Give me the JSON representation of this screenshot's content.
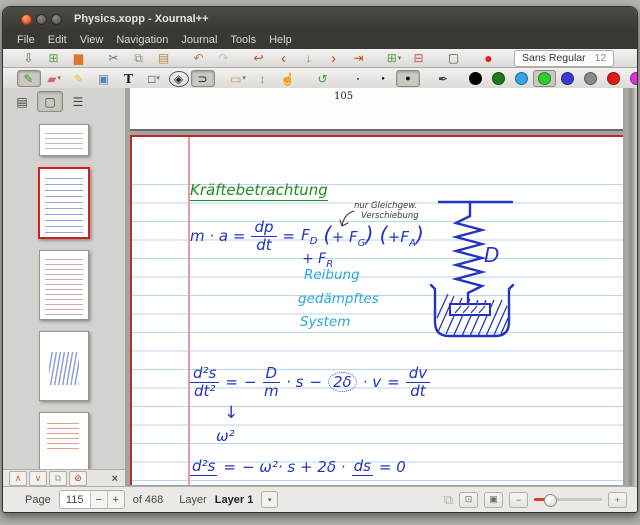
{
  "window": {
    "title": "Physics.xopp - Xournal++"
  },
  "menu": {
    "items": [
      {
        "name": "menu-file",
        "label": "File"
      },
      {
        "name": "menu-edit",
        "label": "Edit"
      },
      {
        "name": "menu-view",
        "label": "View"
      },
      {
        "name": "menu-navigation",
        "label": "Navigation"
      },
      {
        "name": "menu-journal",
        "label": "Journal"
      },
      {
        "name": "menu-tools",
        "label": "Tools"
      },
      {
        "name": "menu-help",
        "label": "Help"
      }
    ]
  },
  "toolbar_main": {
    "buttons": [
      {
        "name": "save-button",
        "glyph": "⇩",
        "color": "#47743f"
      },
      {
        "name": "new-document-button",
        "glyph": "⊞",
        "color": "#5f9e4c"
      },
      {
        "name": "open-button",
        "glyph": "▆",
        "color": "#e0762e"
      },
      {
        "name": "cut-button",
        "glyph": "✂",
        "color": "#6f6d68",
        "gap": true
      },
      {
        "name": "copy-button",
        "glyph": "⧉",
        "color": "#8f8d88"
      },
      {
        "name": "paste-button",
        "glyph": "▤",
        "color": "#b5884a"
      },
      {
        "name": "undo-button",
        "glyph": "↶",
        "color": "#c2704f",
        "gap": true
      },
      {
        "name": "redo-button",
        "glyph": "↷",
        "color": "#c6c3bd"
      },
      {
        "name": "page-back-button",
        "glyph": "↩",
        "color": "#c14a28",
        "gap": true
      },
      {
        "name": "previous-page-button",
        "glyph": "‹",
        "color": "#c14a28",
        "fs": "15px"
      },
      {
        "name": "scroll-down-button",
        "glyph": "↓",
        "color": "#56a23f"
      },
      {
        "name": "next-page-button",
        "glyph": "›",
        "color": "#c14a28",
        "fs": "15px"
      },
      {
        "name": "last-page-button",
        "glyph": "⇥",
        "color": "#c14a28"
      },
      {
        "name": "insert-page-button",
        "glyph": "⊞",
        "color": "#5f9e4c",
        "dd": "▾",
        "gap": true
      },
      {
        "name": "delete-page-button",
        "glyph": "⊟",
        "color": "#c0564a"
      },
      {
        "name": "presentation-button",
        "glyph": "▢",
        "color": "#55534d",
        "gap": true
      },
      {
        "name": "record-audio-button",
        "glyph": "●",
        "color": "#dc1e1e",
        "fs": "14px",
        "gap": true
      }
    ],
    "font_button": {
      "family": "Sans Regular",
      "size": "12"
    }
  },
  "toolbar_tools": {
    "buttons": [
      {
        "name": "pen-tool-button",
        "glyph": "✎",
        "color": "#3f8f3c",
        "active": true
      },
      {
        "name": "eraser-tool-button",
        "glyph": "▰",
        "color": "#d26a6a",
        "dd": "▾"
      },
      {
        "name": "highlighter-tool-button",
        "glyph": "✎",
        "color": "#d4c829"
      },
      {
        "name": "image-tool-button",
        "glyph": "▣",
        "color": "#5b7fb4"
      },
      {
        "name": "text-tool-button",
        "glyph": "T",
        "color": "#1c1c1c"
      },
      {
        "name": "shape-tool-button",
        "glyph": "□",
        "color": "#333333",
        "dd": "▾"
      },
      {
        "name": "rotation-snapping-button",
        "glyph": "◈",
        "color": "#222222",
        "gap": true
      },
      {
        "name": "grid-snapping-button",
        "glyph": "⊃",
        "color": "#222222",
        "active": true
      },
      {
        "name": "select-rectangle-button",
        "glyph": "▭",
        "color": "#c89a5a",
        "dd": "▾",
        "gap": true
      },
      {
        "name": "vertical-space-button",
        "glyph": "↕",
        "color": "#b5884a"
      },
      {
        "name": "hand-tool-button",
        "glyph": "☝",
        "color": "#2b2b2b"
      },
      {
        "name": "default-tool-button",
        "glyph": "↺",
        "color": "#3f9d3f",
        "gap": true
      }
    ],
    "thickness": [
      {
        "name": "thickness-fine-button",
        "glyph": "●",
        "color": "#111111",
        "fs": "4px",
        "gap": true
      },
      {
        "name": "thickness-medium-button",
        "glyph": "●",
        "color": "#111111",
        "fs": "6px"
      },
      {
        "name": "thickness-thick-button",
        "glyph": "●",
        "color": "#111111",
        "fs": "9px",
        "active": true
      }
    ],
    "color_picker_glyph": "✒",
    "colors": [
      {
        "name": "color-swatch-black",
        "hex": "#000000"
      },
      {
        "name": "color-swatch-dark-green",
        "hex": "#1d7a1d"
      },
      {
        "name": "color-swatch-light-blue",
        "hex": "#35a6e0"
      },
      {
        "name": "color-swatch-green",
        "hex": "#2ecc2e",
        "selected": true
      },
      {
        "name": "color-swatch-blue",
        "hex": "#3b3bd1"
      },
      {
        "name": "color-swatch-gray",
        "hex": "#8a8a8a"
      },
      {
        "name": "color-swatch-red",
        "hex": "#e01b1b"
      },
      {
        "name": "color-swatch-magenta",
        "hex": "#e231e2"
      },
      {
        "name": "color-swatch-orange",
        "hex": "#f08c1e"
      },
      {
        "name": "color-swatch-yellow",
        "hex": "#f0e11e"
      },
      {
        "name": "color-swatch-white",
        "hex": "#ffffff"
      }
    ],
    "custom_color": {
      "hex": "#2ecc2e"
    }
  },
  "sidebar": {
    "tabs": [
      {
        "name": "tab-contents",
        "glyph": "▤"
      },
      {
        "name": "tab-page-preview",
        "glyph": "▢",
        "active": true
      },
      {
        "name": "tab-layers",
        "glyph": "☰"
      }
    ],
    "thumbnails": [
      {
        "name": "page-thumbnail-1",
        "kind": "partial"
      },
      {
        "name": "page-thumbnail-2-current",
        "kind": "current",
        "selected": true
      },
      {
        "name": "page-thumbnail-3",
        "kind": "dense"
      },
      {
        "name": "page-thumbnail-4",
        "kind": "waves"
      },
      {
        "name": "page-thumbnail-5",
        "kind": "redtext"
      }
    ],
    "nav": [
      {
        "name": "sidebar-up-button",
        "glyph": "∧",
        "color": "#d0642f"
      },
      {
        "name": "sidebar-down-button",
        "glyph": "∨",
        "color": "#d0642f"
      },
      {
        "name": "sidebar-copy-button",
        "glyph": "⧉",
        "color": "#a8a5a0"
      },
      {
        "name": "sidebar-stop-button",
        "glyph": "⊘",
        "color": "#cc2222"
      }
    ],
    "close_glyph": "×"
  },
  "canvas": {
    "prev_page_number": "105",
    "notes": {
      "heading": "Kräftebetrachtung",
      "annotation_line1": "nur Gleichgew.",
      "annotation_line2": "Verschiebung",
      "f1_lhs": "m · a =",
      "f1_num": "dp",
      "f1_den": "dt",
      "f1_eq": "=",
      "f1_F": "F",
      "f1_F_sub": "D",
      "g1_open": "(",
      "g1_text": "+ F",
      "g1_sub": "G",
      "g1_close": ")",
      "g2_open": "(",
      "g2_text": "+F",
      "g2_sub": "A",
      "g2_close": ")",
      "fr_text": "+ F",
      "fr_sub": "R",
      "friction_label": "Reibung",
      "damped_line1": "gedämpftes",
      "damped_line2": "System",
      "spring_constant_label": "D",
      "f2_num": "d²s",
      "f2_den": "dt²",
      "f2_eq": "=",
      "f2_minus": "−",
      "f2_Dnum": "D",
      "f2_Dden": "m",
      "f2_s": "· s",
      "f2_minus2": "−",
      "f2_circled": "2δ",
      "f2_v": "· v",
      "f2_eq2": "=",
      "f2_dvnum": "dv",
      "f2_dvden": "dt",
      "f2_arrow": "↓",
      "f2_omega": "ω²",
      "f3_num": "d²s",
      "f3_eq": "=",
      "f3_body": "− ω²· s  + 2δ ·",
      "f3_ds": "ds",
      "f3_end": "= 0"
    }
  },
  "statusbar": {
    "page_label": "Page",
    "page_value": "115",
    "decrement_label": "−",
    "increment_label": "+",
    "of_label": "of",
    "total_pages": "468",
    "layer_label": "Layer",
    "layer_value": "Layer 1",
    "layer_dropdown_glyph": "▾",
    "view": {
      "two_page_glyph": "⧉",
      "fit_glyph": "⊡",
      "original_glyph": "▣",
      "zoom_out_glyph": "−",
      "zoom_in_glyph": "+",
      "slider_fill": "22%"
    }
  }
}
